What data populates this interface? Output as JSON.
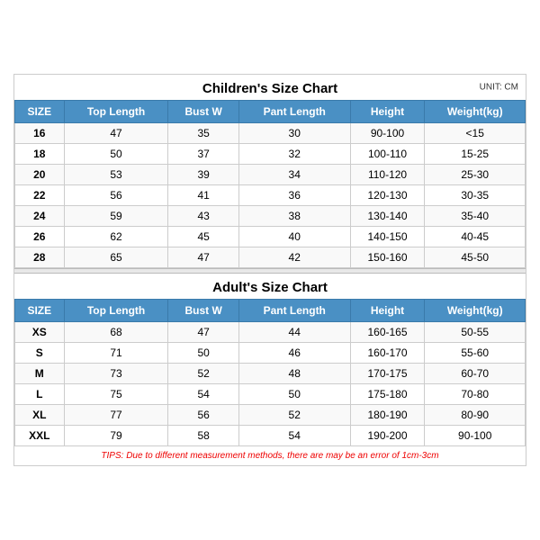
{
  "children_title": "Children's Size Chart",
  "adults_title": "Adult's Size Chart",
  "unit": "UNIT: CM",
  "tips": "TIPS: Due to different measurement methods, there are may be an error of 1cm-3cm",
  "headers": [
    "SIZE",
    "Top Length",
    "Bust W",
    "Pant Length",
    "Height",
    "Weight(kg)"
  ],
  "children_rows": [
    [
      "16",
      "47",
      "35",
      "30",
      "90-100",
      "<15"
    ],
    [
      "18",
      "50",
      "37",
      "32",
      "100-110",
      "15-25"
    ],
    [
      "20",
      "53",
      "39",
      "34",
      "110-120",
      "25-30"
    ],
    [
      "22",
      "56",
      "41",
      "36",
      "120-130",
      "30-35"
    ],
    [
      "24",
      "59",
      "43",
      "38",
      "130-140",
      "35-40"
    ],
    [
      "26",
      "62",
      "45",
      "40",
      "140-150",
      "40-45"
    ],
    [
      "28",
      "65",
      "47",
      "42",
      "150-160",
      "45-50"
    ]
  ],
  "adult_rows": [
    [
      "XS",
      "68",
      "47",
      "44",
      "160-165",
      "50-55"
    ],
    [
      "S",
      "71",
      "50",
      "46",
      "160-170",
      "55-60"
    ],
    [
      "M",
      "73",
      "52",
      "48",
      "170-175",
      "60-70"
    ],
    [
      "L",
      "75",
      "54",
      "50",
      "175-180",
      "70-80"
    ],
    [
      "XL",
      "77",
      "56",
      "52",
      "180-190",
      "80-90"
    ],
    [
      "XXL",
      "79",
      "58",
      "54",
      "190-200",
      "90-100"
    ]
  ]
}
